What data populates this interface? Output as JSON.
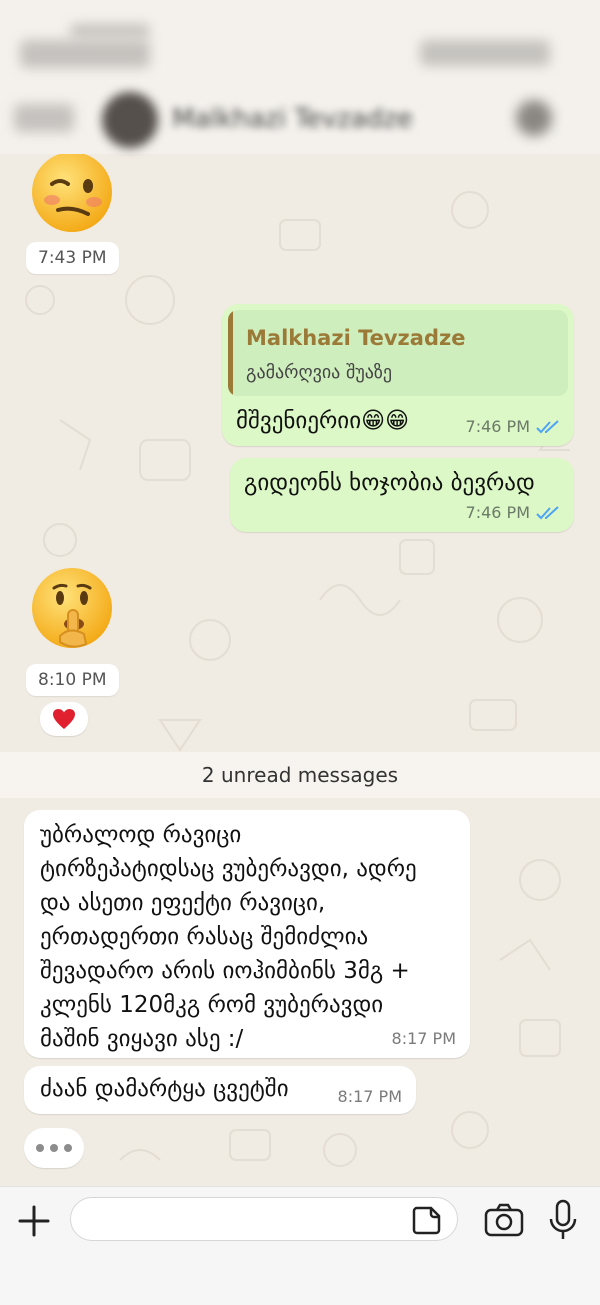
{
  "header": {
    "contact_name": "Malkhazi Tevzadze"
  },
  "messages": {
    "emoji1": {
      "emoji": "woozy-face",
      "time": "7:43 PM"
    },
    "out1": {
      "quote_name": "Malkhazi Tevzadze",
      "quote_text": "გამარღვია შუაზე",
      "text": "მშვენიერიი😁😁",
      "time": "7:46 PM"
    },
    "out2": {
      "text": "გიდეონს ხოჯობია ბევრად",
      "time": "7:46 PM"
    },
    "emoji2": {
      "emoji": "shushing-face",
      "time": "8:10 PM",
      "reaction": "❤️"
    },
    "unread_banner": "2 unread messages",
    "in1": {
      "lines": [
        "უბრალოდ რავიცი",
        "ტირზეპატიდსაც ვუბერავდი, ადრე",
        "და ასეთი ეფექტი რავიცი,",
        "ერთადერთი რასაც შემიძლია",
        "შევადარო არის იოჰიმბინს 3მგ +",
        "კლენს 120მკგ რომ ვუბერავდი",
        "მაშინ ვიყავი ასე :/"
      ],
      "time": "8:17 PM"
    },
    "in2": {
      "text": "ძაან დამარტყა ცვეტში",
      "time": "8:17 PM"
    }
  },
  "input": {
    "placeholder": "",
    "value": ""
  },
  "colors": {
    "outgoing_bubble": "#dcf8c6",
    "incoming_bubble": "#ffffff",
    "read_ticks": "#4fa3f7",
    "quote_accent": "#9b7a38",
    "background": "#f0ebe3"
  },
  "icons": [
    "plus-icon",
    "sticker-icon",
    "camera-icon",
    "microphone-icon",
    "double-check-icon"
  ]
}
